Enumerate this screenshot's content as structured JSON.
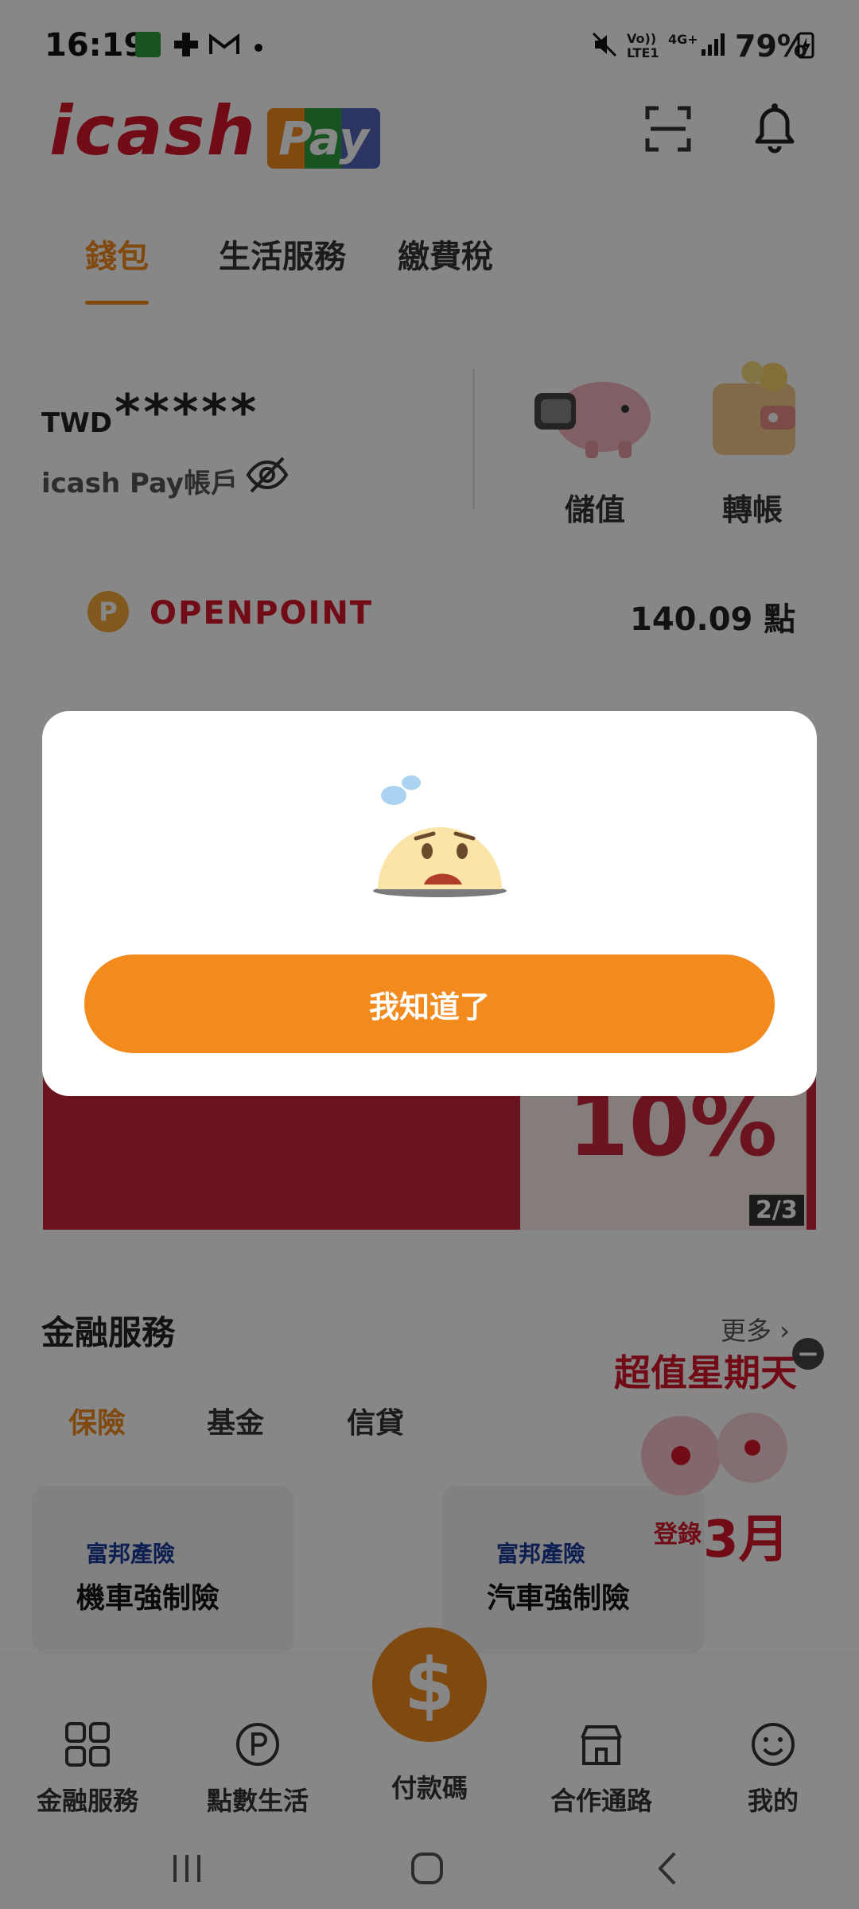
{
  "status_bar": {
    "time": "16:19",
    "battery": "79%",
    "network": "4G+",
    "lte": "LTE1",
    "volte": "Vo))"
  },
  "header": {
    "brand_main": "icash",
    "brand_sub": "Pay"
  },
  "tabs": [
    {
      "label": "錢包",
      "active": true
    },
    {
      "label": "生活服務",
      "active": false
    },
    {
      "label": "繳費稅",
      "active": false
    }
  ],
  "wallet": {
    "currency": "TWD",
    "balance_masked": "*****",
    "account_label": "icash Pay帳戶",
    "actions": [
      {
        "label": "儲值",
        "icon": "piggy-bank-icon"
      },
      {
        "label": "轉帳",
        "icon": "wallet-icon"
      }
    ]
  },
  "openpoint": {
    "logo_text": "OPENPOINT",
    "coin_letter": "P",
    "points": "140.09 點"
  },
  "banner": {
    "big_text": "10%",
    "page_indicator": "2/3"
  },
  "finance": {
    "title": "金融服務",
    "more_label": "更多",
    "subtabs": [
      {
        "label": "保險",
        "active": true
      },
      {
        "label": "基金",
        "active": false
      },
      {
        "label": "信貸",
        "active": false
      }
    ],
    "cards": [
      {
        "brand": "富邦產險",
        "title": "機車強制險"
      },
      {
        "brand": "富邦產險",
        "title": "汽車強制險"
      }
    ],
    "promo": {
      "title": "超值星期天",
      "month_prefix": "登錄",
      "month": "3月",
      "close": "−"
    }
  },
  "bottom_nav": {
    "items": [
      {
        "label": "金融服務",
        "icon": "finance-grid-icon"
      },
      {
        "label": "點數生活",
        "icon": "points-p-icon"
      },
      {
        "label": "付款碼",
        "icon": "dollar-icon"
      },
      {
        "label": "合作通路",
        "icon": "store-icon"
      },
      {
        "label": "我的",
        "icon": "smiley-icon"
      }
    ],
    "pay_symbol": "$"
  },
  "modal": {
    "emoji_icon": "worried-face-icon",
    "button_label": "我知道了"
  },
  "colors": {
    "accent": "#f08b1e",
    "brand_red": "#d6182b",
    "overlay": "rgba(0,0,0,0.47)"
  }
}
